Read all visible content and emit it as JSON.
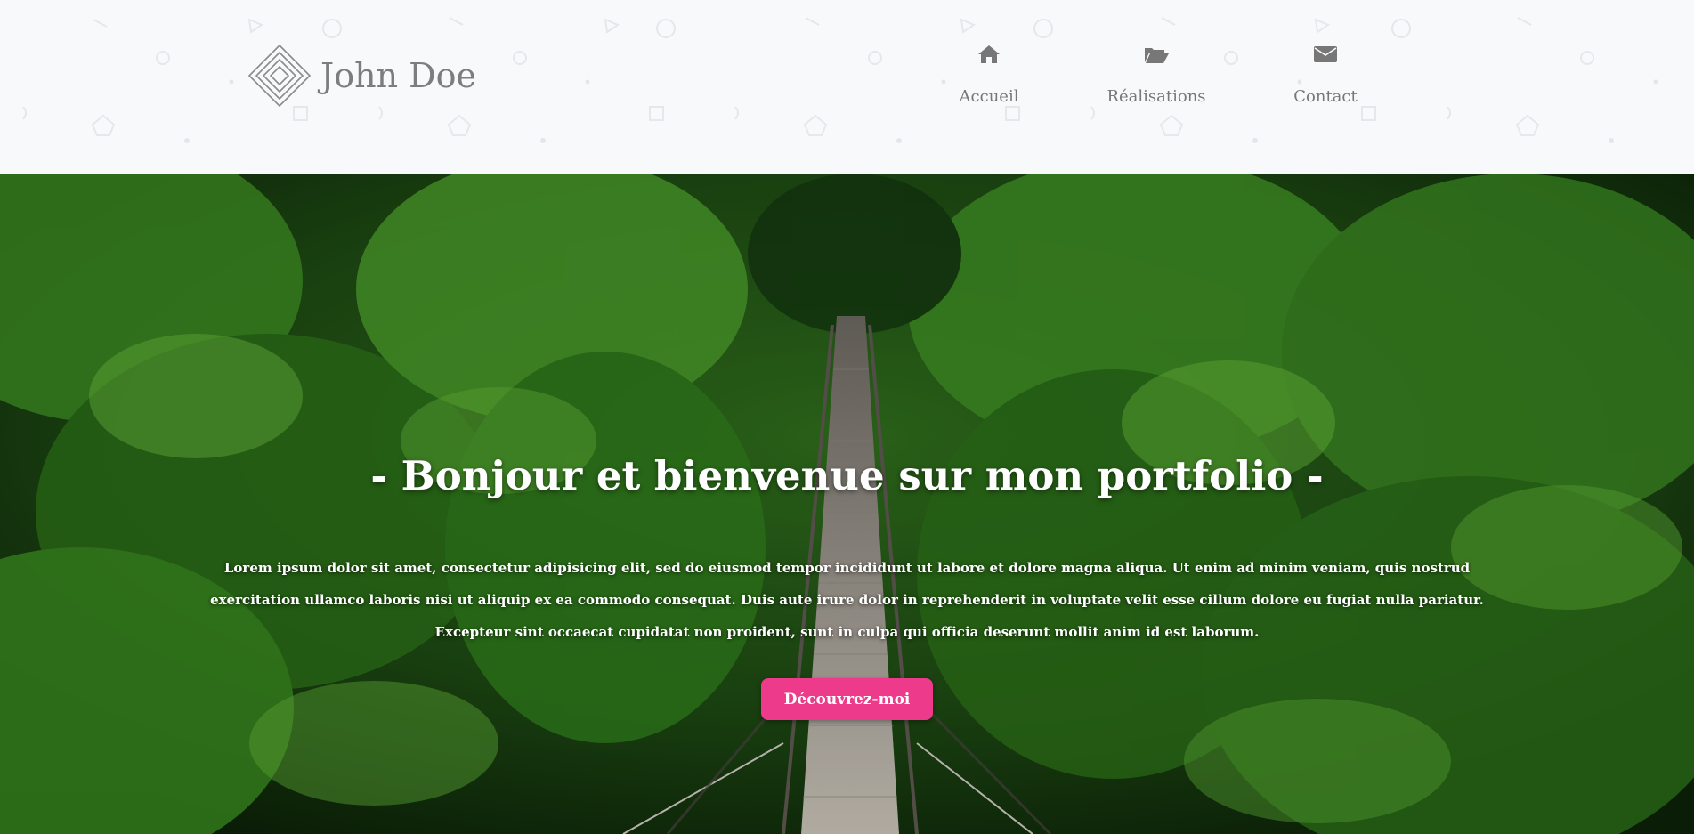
{
  "brand": {
    "name": "John Doe",
    "logo_icon": "nested-diamond-logo"
  },
  "nav": {
    "items": [
      {
        "label": "Accueil",
        "icon": "home-icon"
      },
      {
        "label": "Réalisations",
        "icon": "folder-open-icon"
      },
      {
        "label": "Contact",
        "icon": "envelope-icon"
      }
    ]
  },
  "hero": {
    "title": "- Bonjour et bienvenue sur mon portfolio -",
    "paragraph": "Lorem ipsum dolor sit amet, consectetur adipisicing elit, sed do eiusmod tempor incididunt ut labore et dolore magna aliqua. Ut enim ad minim veniam, quis nostrud exercitation ullamco laboris nisi ut aliquip ex ea commodo consequat. Duis aute irure dolor in reprehenderit in voluptate velit esse cillum dolore eu fugiat nulla pariatur. Excepteur sint occaecat cupidatat non proident, sunt in culpa qui officia deserunt mollit anim id est laborum.",
    "button_label": "Découvrez-moi",
    "background": "forest suspension bridge photo"
  },
  "colors": {
    "header_bg": "#f8f9fa",
    "text_grey": "#777777",
    "accent_pink": "#ee3a8a"
  }
}
